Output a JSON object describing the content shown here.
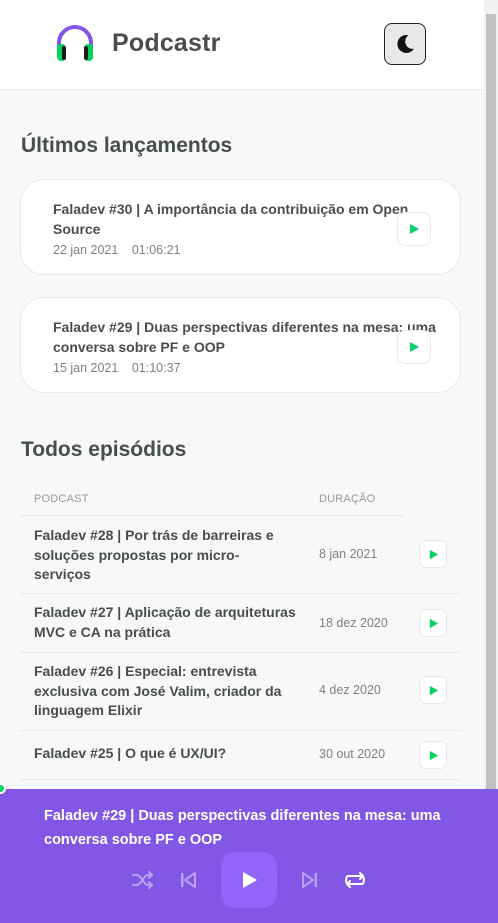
{
  "header": {
    "app_title": "Podcastr",
    "logo_icon": "headphones-icon",
    "theme_icon": "moon-icon"
  },
  "latest": {
    "section_title": "Últimos lançamentos",
    "items": [
      {
        "title": "Faladev #30 | A importância da contribuição em Open Source",
        "date": "22 jan 2021",
        "duration": "01:06:21"
      },
      {
        "title": "Faladev #29 | Duas perspectivas diferentes na mesa: uma conversa sobre PF e OOP",
        "date": "15 jan 2021",
        "duration": "01:10:37"
      }
    ]
  },
  "all": {
    "section_title": "Todos episódios",
    "columns": {
      "podcast": "Podcast",
      "duration": "Duração"
    },
    "rows": [
      {
        "title": "Faladev #28 | Por trás de barreiras e soluções propostas por micro-serviços",
        "date": "8 jan 2021"
      },
      {
        "title": "Faladev #27 | Aplicação de arquiteturas MVC e CA na prática",
        "date": "18 dez 2020"
      },
      {
        "title": "Faladev #26 | Especial: entrevista exclusiva com José Valim, criador da linguagem Elixir",
        "date": "4 dez 2020"
      },
      {
        "title": "Faladev #25 | O que é UX/UI?",
        "date": "30 out 2020"
      }
    ]
  },
  "player": {
    "now_playing": "Faladev #29 | Duas perspectivas diferentes na mesa: uma conversa sobre PF e OOP",
    "progress": 0,
    "controls": [
      "shuffle-icon",
      "previous-icon",
      "play-icon",
      "next-icon",
      "repeat-icon"
    ]
  },
  "colors": {
    "accent": "#8257e5",
    "play_green": "#04d361"
  }
}
